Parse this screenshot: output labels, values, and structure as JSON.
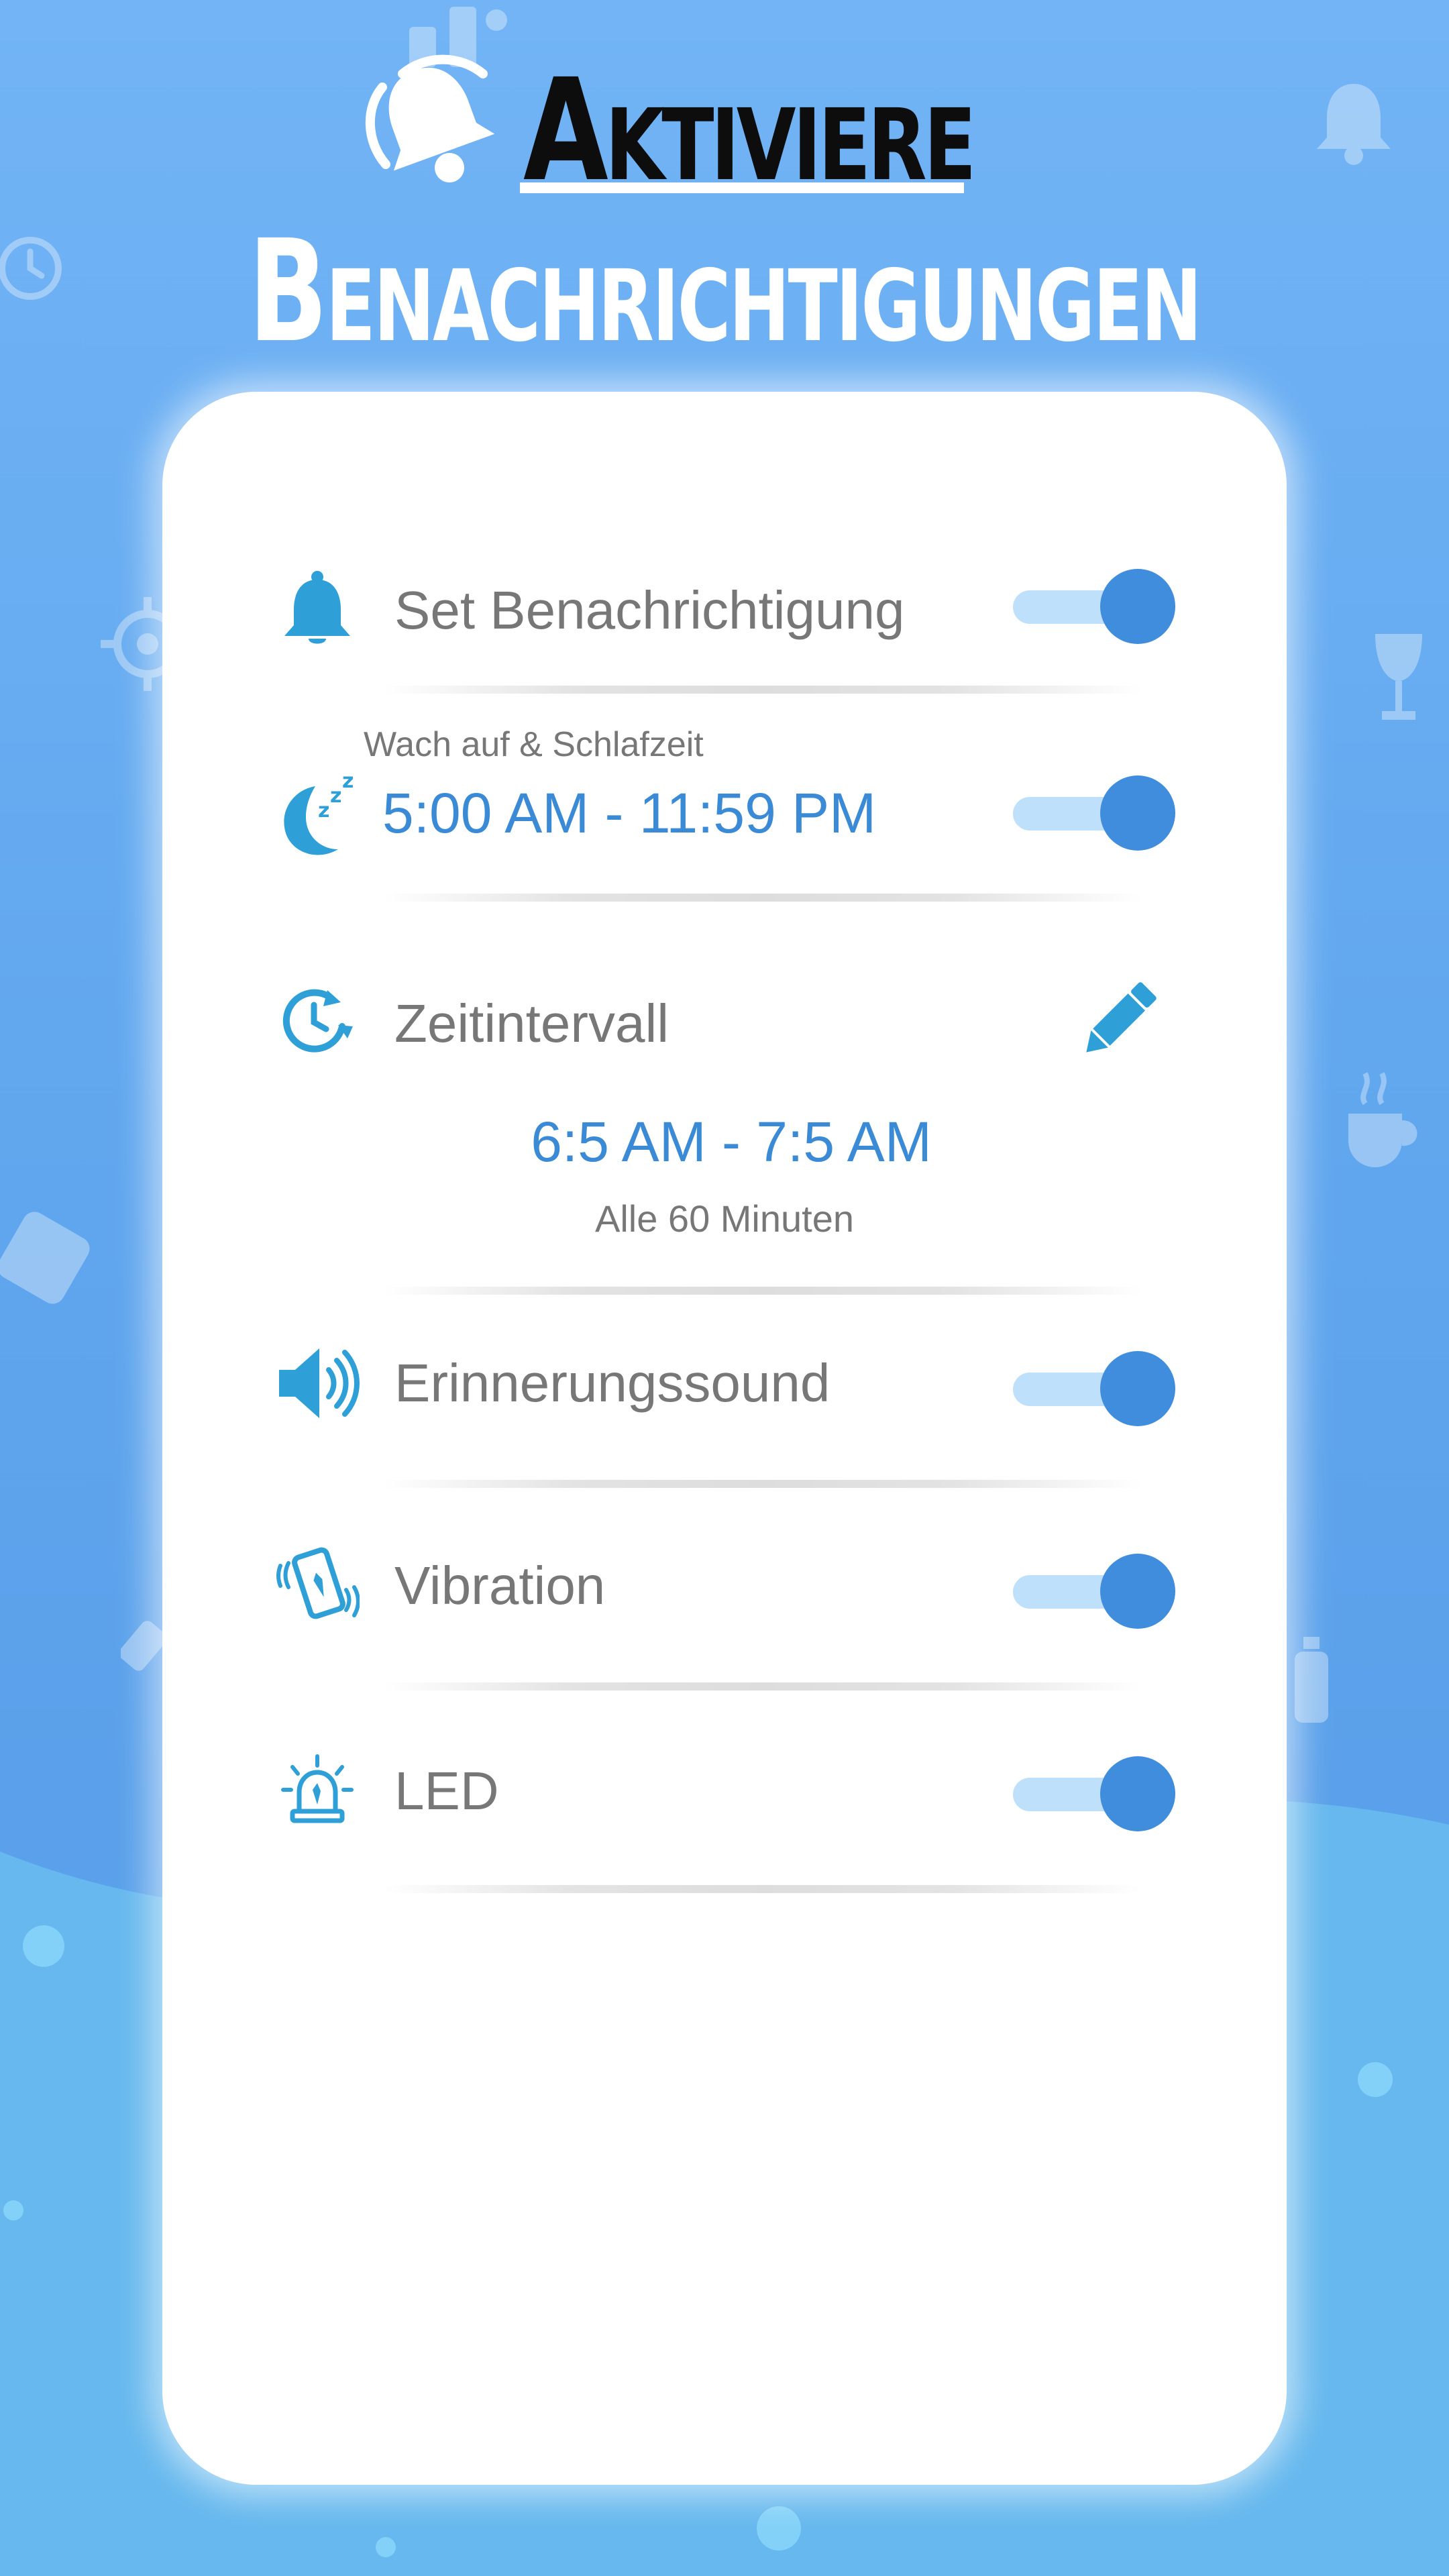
{
  "header": {
    "title_line1": "Aktiviere",
    "title_line2": "Benachrichtigungen"
  },
  "settings": {
    "set_notification": {
      "label": "Set Benachrichtigung",
      "enabled": true
    },
    "wake_sleep": {
      "caption": "Wach auf & Schlafzeit",
      "time_range": "5:00 AM - 11:59 PM",
      "enabled": true
    },
    "interval": {
      "label": "Zeitintervall",
      "time_range": "6:5 AM - 7:5 AM",
      "frequency": "Alle 60 Minuten"
    },
    "reminder_sound": {
      "label": "Erinnerungssound",
      "enabled": true
    },
    "vibration": {
      "label": "Vibration",
      "enabled": true
    },
    "led": {
      "label": "LED",
      "enabled": true
    }
  },
  "colors": {
    "accent": "#3f8ddc",
    "icon_blue": "#2f9fd8",
    "track": "#bfe0fa",
    "label_gray": "#777777"
  }
}
